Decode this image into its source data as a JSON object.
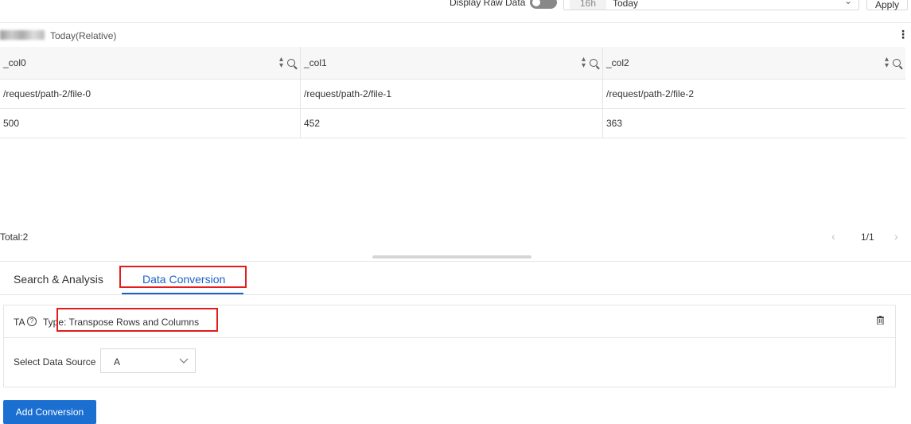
{
  "top_bar": {
    "raw_data_label": "Display Raw Data",
    "time_range_tag": "16h",
    "time_range_value": "Today",
    "apply_label": "Apply"
  },
  "chart": {
    "time_label": "Today(Relative)",
    "columns": [
      "_col0",
      "_col1",
      "_col2"
    ],
    "rows": [
      [
        "/request/path-2/file-0",
        "/request/path-2/file-1",
        "/request/path-2/file-2"
      ],
      [
        "500",
        "452",
        "363"
      ]
    ],
    "total": "Total:2",
    "pager": "1/1"
  },
  "tabs": [
    {
      "label": "Search & Analysis",
      "active": false
    },
    {
      "label": "Data Conversion",
      "active": true
    }
  ],
  "conversion": {
    "id": "TA",
    "type_label": "Type: Transpose Rows and Columns",
    "data_source_label": "Select Data Source",
    "data_source_value": "A",
    "add_button": "Add Conversion"
  },
  "colors": {
    "accent": "#1a62c4",
    "highlight": "#e31c1c",
    "button": "#1a6fd1"
  }
}
